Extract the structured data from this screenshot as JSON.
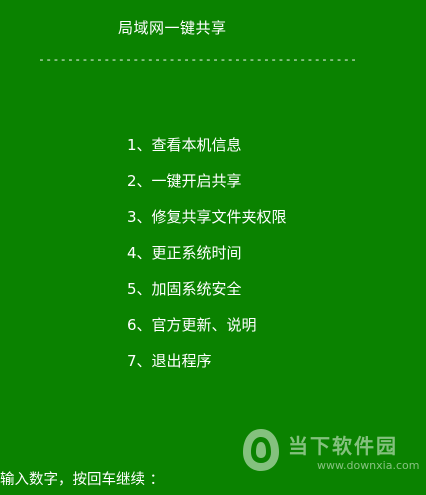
{
  "title": "局域网一键共享",
  "divider": "--------------------------------------------",
  "menu": [
    {
      "label": "1、查看本机信息"
    },
    {
      "label": "2、一键开启共享"
    },
    {
      "label": "3、修复共享文件夹权限"
    },
    {
      "label": "4、更正系统时间"
    },
    {
      "label": "5、加固系统安全"
    },
    {
      "label": "6、官方更新、说明"
    },
    {
      "label": "7、退出程序"
    }
  ],
  "prompt": "输入数字，按回车继续 ：",
  "watermark": {
    "name": "当下软件园",
    "url": "www.downxia.com"
  },
  "colors": {
    "background": "#0a8200",
    "text": "#ffffff"
  }
}
